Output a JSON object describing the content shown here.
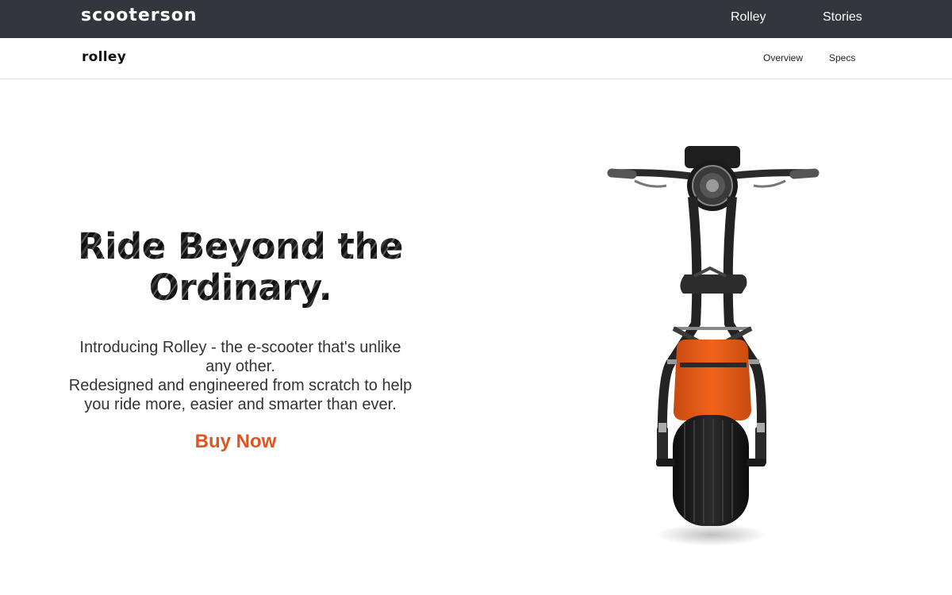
{
  "header": {
    "brand": "scooterson",
    "nav": [
      {
        "label": "Rolley"
      },
      {
        "label": "Stories"
      }
    ]
  },
  "subheader": {
    "logo": "rolley",
    "nav": [
      {
        "label": "Overview"
      },
      {
        "label": "Specs"
      }
    ]
  },
  "hero": {
    "title_line1": "Ride Beyond the",
    "title_line2": "Ordinary.",
    "text_lines": [
      "Introducing Rolley - the e-scooter that's unlike",
      "any other.",
      "Redesigned and engineered from scratch to help",
      "you ride more, easier and smarter than ever."
    ],
    "cta": "Buy Now"
  },
  "colors": {
    "topbar": "#33363d",
    "accent": "#e2531f",
    "scooter_body": "#f0641c"
  },
  "icons": {
    "product_image": "scooter-image"
  }
}
